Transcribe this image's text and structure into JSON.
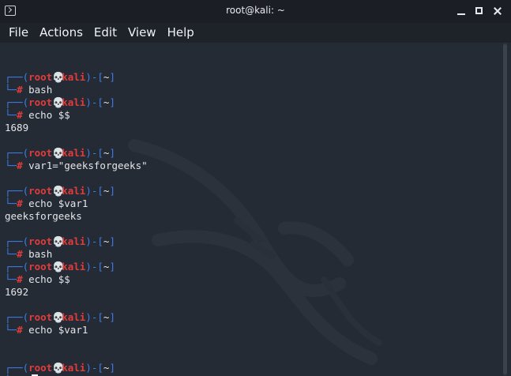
{
  "window": {
    "title": "root@kali: ~"
  },
  "menu": [
    "File",
    "Actions",
    "Edit",
    "View",
    "Help"
  ],
  "prompt": {
    "top_prefix": "┌──(",
    "user": "root",
    "skull": "💀",
    "host": "kali",
    "top_suffix": ")-[",
    "cwd": "~",
    "top_end": "]",
    "bottom_prefix": "└─",
    "hash": "#"
  },
  "lines": [
    {
      "type": "blank"
    },
    {
      "type": "prompt-top"
    },
    {
      "type": "prompt-cmd",
      "cmd": "bash"
    },
    {
      "type": "prompt-top"
    },
    {
      "type": "prompt-cmd",
      "cmd": "echo $$"
    },
    {
      "type": "output",
      "text": "1689"
    },
    {
      "type": "blank"
    },
    {
      "type": "prompt-top"
    },
    {
      "type": "prompt-cmd",
      "cmd": "var1=\"geeksforgeeks\""
    },
    {
      "type": "blank"
    },
    {
      "type": "prompt-top"
    },
    {
      "type": "prompt-cmd",
      "cmd": "echo $var1"
    },
    {
      "type": "output",
      "text": "geeksforgeeks"
    },
    {
      "type": "blank"
    },
    {
      "type": "prompt-top"
    },
    {
      "type": "prompt-cmd",
      "cmd": "bash"
    },
    {
      "type": "prompt-top"
    },
    {
      "type": "prompt-cmd",
      "cmd": "echo $$"
    },
    {
      "type": "output",
      "text": "1692"
    },
    {
      "type": "blank"
    },
    {
      "type": "prompt-top"
    },
    {
      "type": "prompt-cmd",
      "cmd": "echo $var1"
    },
    {
      "type": "blank"
    },
    {
      "type": "blank"
    },
    {
      "type": "prompt-top"
    },
    {
      "type": "prompt-cmd",
      "cmd": "",
      "cursor": true
    }
  ],
  "colors": {
    "background": "#252b34",
    "prompt_frame": "#3d7de6",
    "prompt_user_host": "#e23b3b",
    "text": "#e3e5ea"
  }
}
